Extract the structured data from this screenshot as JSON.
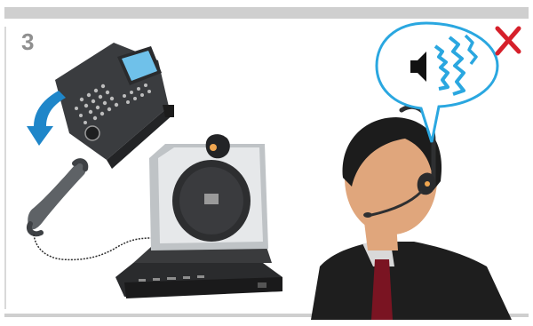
{
  "step": {
    "number": "3"
  },
  "icons": {
    "desk_phone": "desk-phone-icon",
    "lift_arrow": "curved-arrow-icon",
    "handset": "handset-icon",
    "headset_base": "headset-base-station-icon",
    "speaker": "speaker-sound-icon",
    "no_mark": "red-x-icon",
    "person": "person-with-headset-icon"
  },
  "colors": {
    "arrow_blue": "#1f86c9",
    "sound_blue": "#2aa7e0",
    "x_red": "#d6202b",
    "skin": "#e0a67c",
    "hair": "#1c1c1c",
    "suit": "#1e1e1e",
    "tie": "#7a1422",
    "bar_gray": "#cfcfcf"
  }
}
